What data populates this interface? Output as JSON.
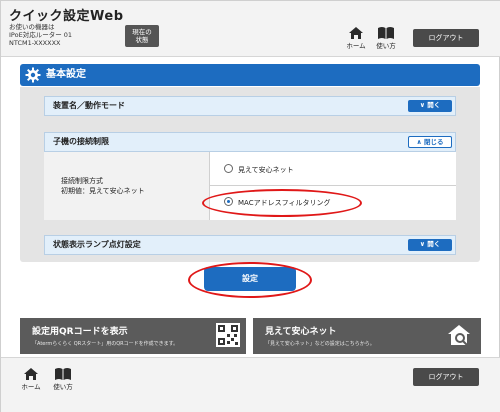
{
  "header": {
    "app_title": "クイック設定Web",
    "device_line1": "お使いの機器は",
    "device_line2": "IPoE対応ルーター 01",
    "device_line3": "NTCM1-XXXXXX",
    "status_line1": "現在の",
    "status_line2": "状態",
    "home_label": "ホーム",
    "manual_label": "使い方",
    "logout_label": "ログアウト"
  },
  "section": {
    "title": "基本設定"
  },
  "accordions": {
    "device_mode": {
      "label": "装置名／動作モード",
      "button": "開く"
    },
    "child_restriction": {
      "label": "子機の接続制限",
      "button": "閉じる"
    },
    "lamp": {
      "label": "状態表示ランプ点灯設定",
      "button": "開く"
    }
  },
  "restriction": {
    "label_line1": "接続制限方式",
    "label_line2": "初期値：見えて安心ネット",
    "option1": "見えて安心ネット",
    "option2": "MACアドレスフィルタリング",
    "selected": "MACアドレスフィルタリング"
  },
  "set_button": "設定",
  "cards": {
    "qr": {
      "title": "設定用QRコードを表示",
      "subtitle": "「Atermらくらく QRスタート」用のQRコードを作成できます。"
    },
    "mieru": {
      "title": "見えて安心ネット",
      "subtitle": "「見えて安心ネット」などの設定はこちらから。"
    }
  },
  "footer": {
    "home_label": "ホーム",
    "manual_label": "使い方",
    "logout_label": "ログアウト"
  },
  "colors": {
    "brand_blue": "#1d6cc0",
    "highlight_red": "#e01818",
    "card_gray": "#5b5b5b"
  }
}
